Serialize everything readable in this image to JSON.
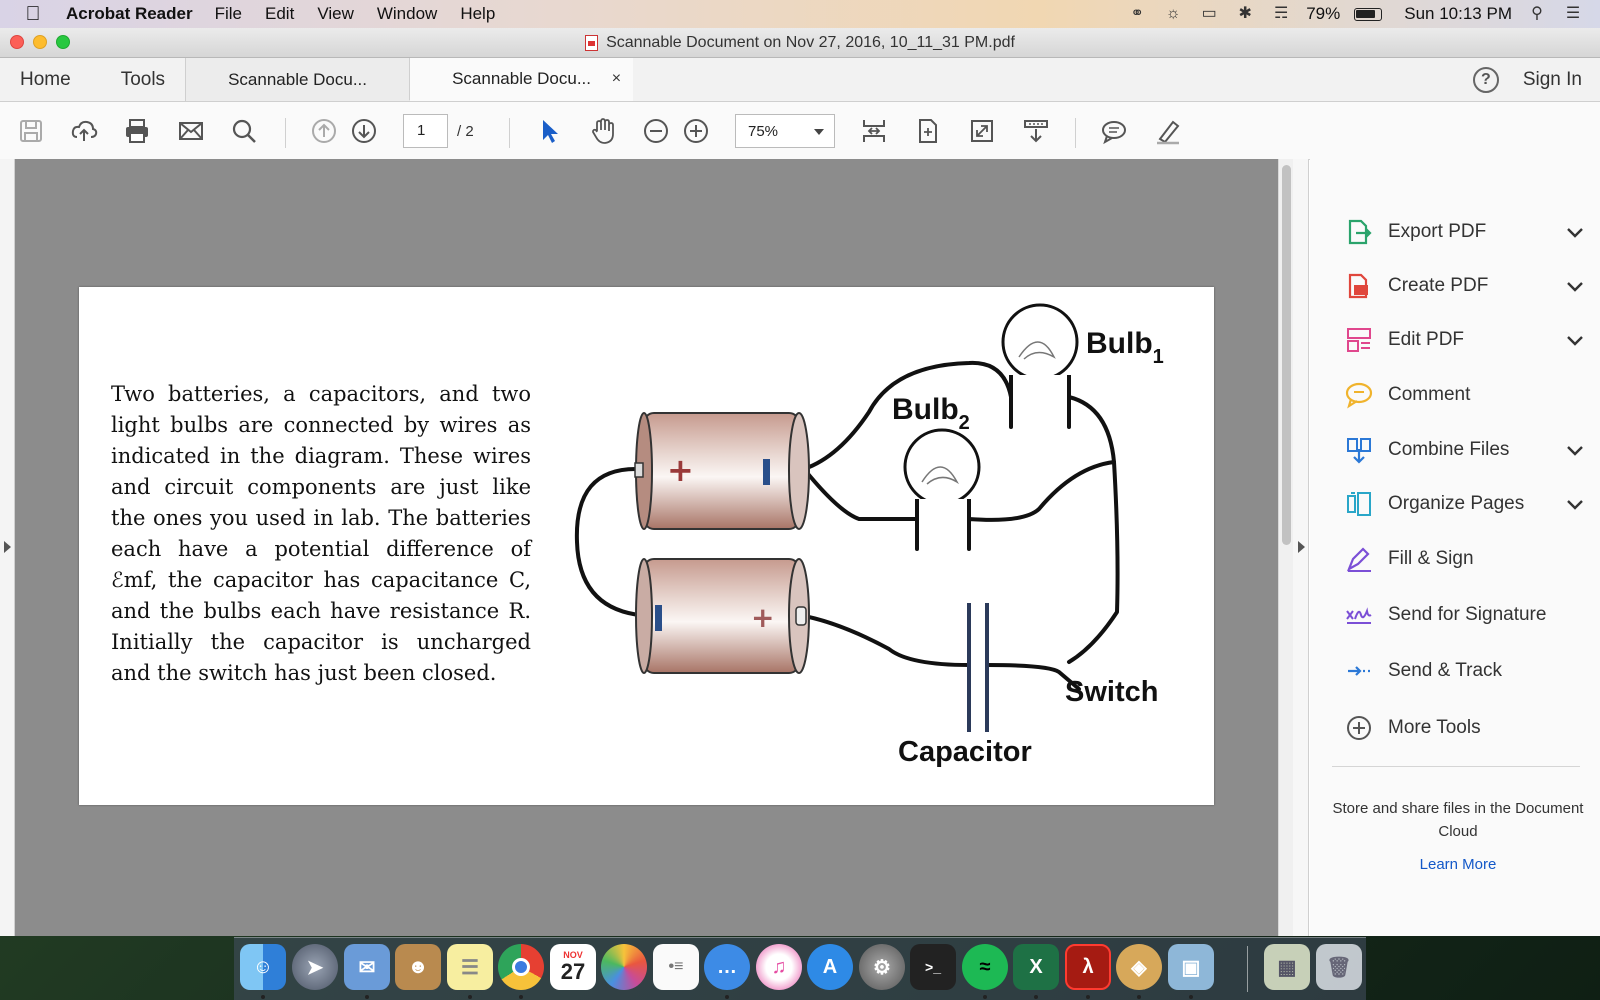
{
  "menubar": {
    "app_name": "Acrobat Reader",
    "menus": [
      "File",
      "Edit",
      "View",
      "Window",
      "Help"
    ],
    "battery_percent": "79%",
    "clock": "Sun 10:13 PM"
  },
  "window": {
    "title": "Scannable Document on Nov 27, 2016, 10_11_31 PM.pdf"
  },
  "tabs": {
    "home": "Home",
    "tools": "Tools",
    "documents": [
      {
        "label": "Scannable Docu...",
        "active": false
      },
      {
        "label": "Scannable Docu...",
        "active": true,
        "close": "×"
      }
    ],
    "help": "?",
    "sign_in": "Sign In"
  },
  "toolbar": {
    "current_page": "1",
    "page_total": "/ 2",
    "zoom": "75%"
  },
  "document": {
    "paragraph": "Two batteries, a capacitors, and two light bulbs are connected by wires as indicated in the diagram. These wires and circuit components are just like the ones you used in lab. The batteries each have a potential difference of ℰmf, the capacitor has capacitance C, and the bulbs each have resistance R. Initially the capacitor is uncharged and the switch has just been closed.",
    "diagram_labels": {
      "bulb1": "Bulb",
      "bulb1_sub": "1",
      "bulb2": "Bulb",
      "bulb2_sub": "2",
      "switch": "Switch",
      "capacitor": "Capacitor",
      "plus": "+",
      "minus": "-"
    }
  },
  "tools_pane": {
    "items": [
      {
        "label": "Export PDF",
        "icon": "export-pdf-icon",
        "color": "#2aa36b",
        "expandable": true
      },
      {
        "label": "Create PDF",
        "icon": "create-pdf-icon",
        "color": "#e0463c",
        "expandable": true
      },
      {
        "label": "Edit PDF",
        "icon": "edit-pdf-icon",
        "color": "#e0478d",
        "expandable": true
      },
      {
        "label": "Comment",
        "icon": "comment-icon",
        "color": "#f0b32c",
        "expandable": false
      },
      {
        "label": "Combine Files",
        "icon": "combine-files-icon",
        "color": "#2b78d6",
        "expandable": true
      },
      {
        "label": "Organize Pages",
        "icon": "organize-pages-icon",
        "color": "#29a6c8",
        "expandable": true
      },
      {
        "label": "Fill & Sign",
        "icon": "fill-sign-icon",
        "color": "#7b4fd6",
        "expandable": false
      },
      {
        "label": "Send for Signature",
        "icon": "send-signature-icon",
        "color": "#7b4fd6",
        "expandable": false
      },
      {
        "label": "Send & Track",
        "icon": "send-track-icon",
        "color": "#2b78d6",
        "expandable": false
      },
      {
        "label": "More Tools",
        "icon": "more-tools-icon",
        "color": "#555555",
        "expandable": false
      }
    ],
    "cloud_text": "Store and share files in the Document Cloud",
    "learn_more": "Learn More"
  },
  "dock": {
    "calendar_month": "NOV",
    "calendar_day": "27"
  }
}
